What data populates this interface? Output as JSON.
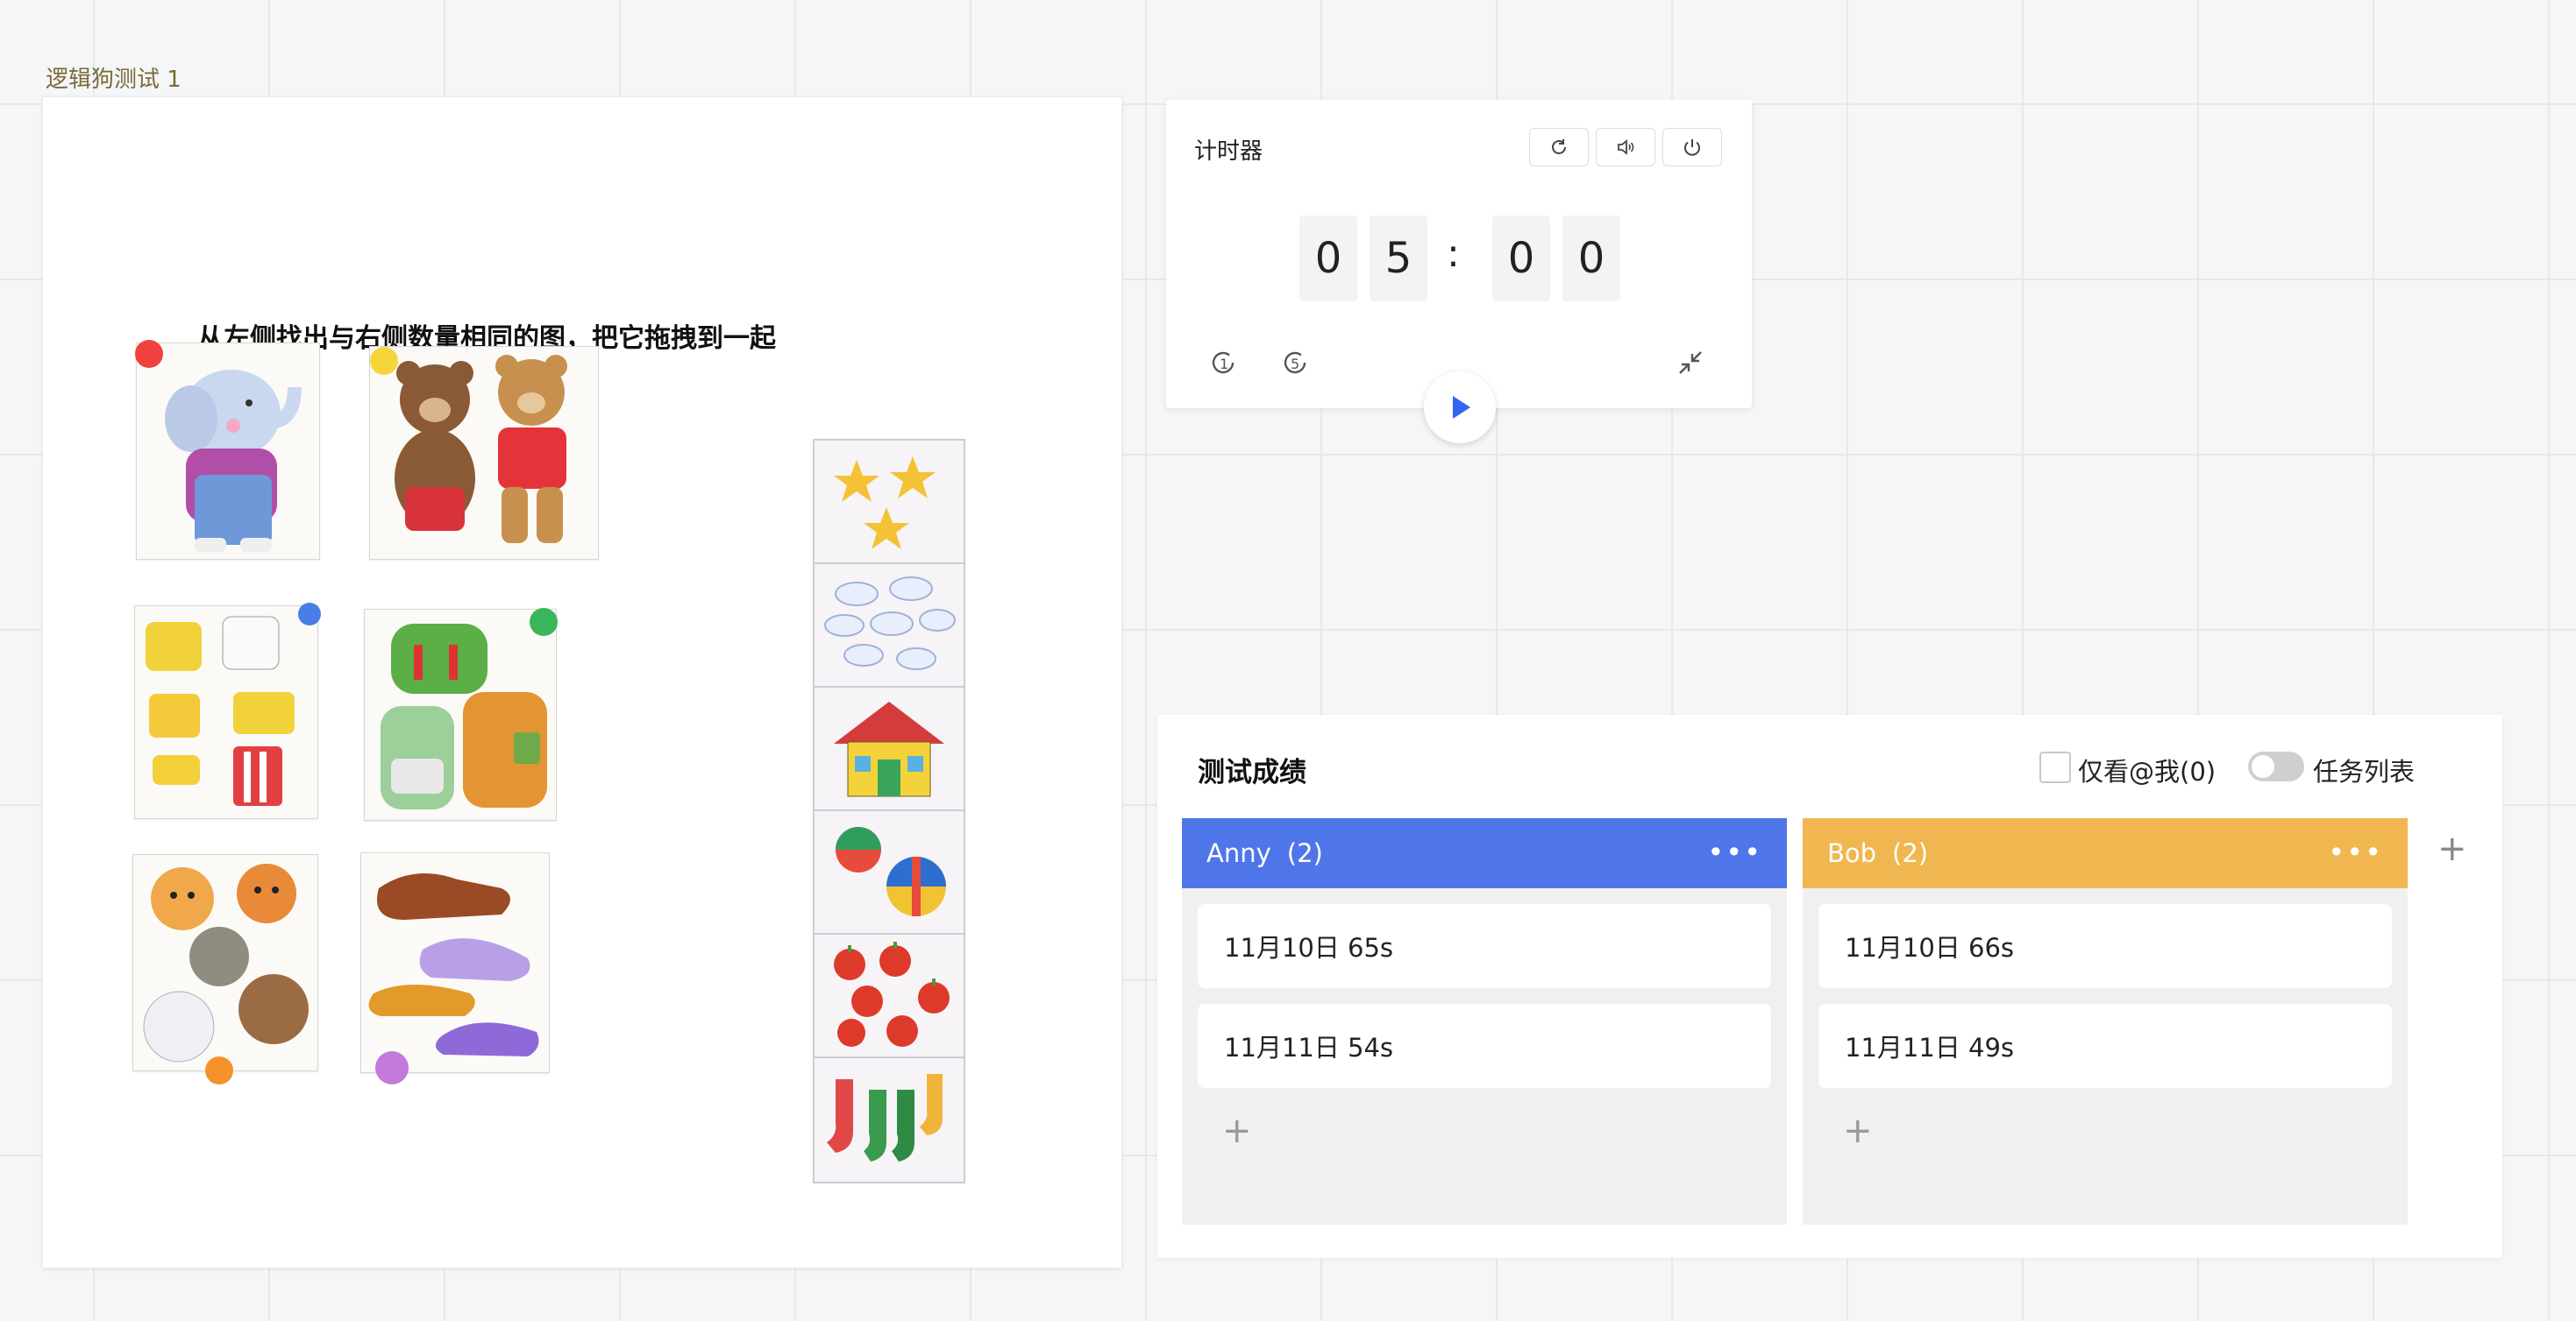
{
  "canvas": {
    "frame_title": "逻辑狗测试 1"
  },
  "card": {
    "instruction": "从左侧找出与右侧数量相同的图，把它拖拽到一起"
  },
  "timer": {
    "title": "计时器",
    "digits": [
      "0",
      "5",
      "0",
      "0"
    ],
    "separator": ":",
    "icons": [
      "refresh-icon",
      "volume-icon",
      "power-icon",
      "plus-one-minute-icon",
      "plus-five-minutes-icon",
      "collapse-icon",
      "play-icon"
    ]
  },
  "scores": {
    "title": "测试成绩",
    "filter_label": "仅看@我(0)",
    "toggle_label": "任务列表",
    "toggle_on": false,
    "add_column": "+",
    "columns": [
      {
        "name": "Anny",
        "count": "(2)",
        "color": "#4f76e8",
        "more": "•••",
        "tasks": [
          "11月10日 65s",
          "11月11日 54s"
        ],
        "add": "+"
      },
      {
        "name": "Bob",
        "count": "(2)",
        "color": "#f0b650",
        "more": "•••",
        "tasks": [
          "11月10日 66s",
          "11月11日 49s"
        ],
        "add": "+"
      }
    ]
  },
  "colors": {
    "red": "#f0413e",
    "yellow": "#f6d53a",
    "blue": "#4a7ee6",
    "green": "#3bb55c",
    "orange": "#f7922a",
    "purple": "#c27bdb"
  }
}
